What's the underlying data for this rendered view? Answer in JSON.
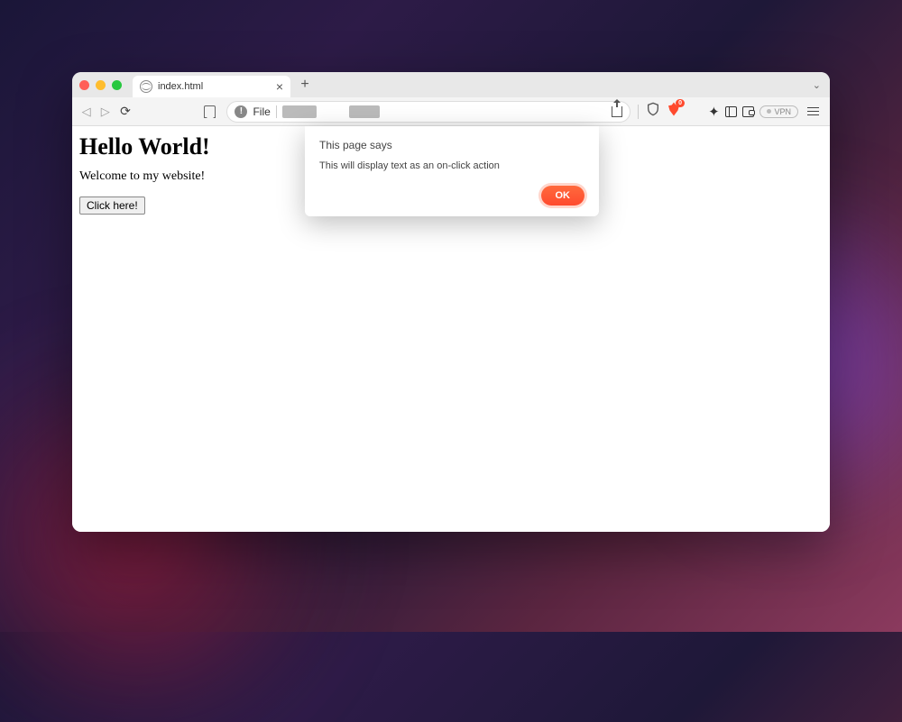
{
  "tab": {
    "title": "index.html"
  },
  "address": {
    "scheme": "File"
  },
  "toolbar": {
    "vpn_label": "VPN",
    "brave_badge": "0"
  },
  "page": {
    "heading": "Hello World!",
    "paragraph": "Welcome to my website!",
    "button_label": "Click here!"
  },
  "alert": {
    "title": "This page says",
    "message": "This will display text as an on-click action",
    "ok_label": "OK"
  }
}
